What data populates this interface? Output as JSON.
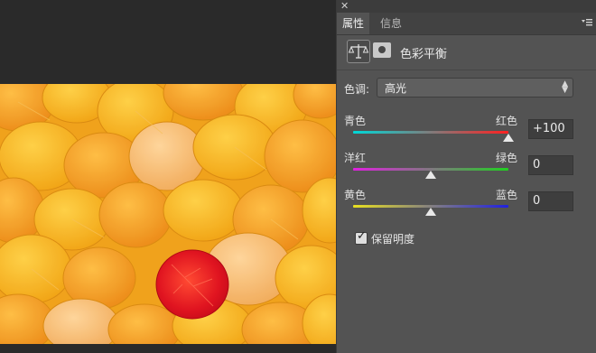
{
  "panel": {
    "tabs": [
      {
        "label": "属性"
      },
      {
        "label": "信息"
      }
    ],
    "title": "色彩平衡",
    "tone": {
      "label": "色调:",
      "value": "高光"
    },
    "sliders": [
      {
        "left_label": "青色",
        "right_label": "红色",
        "value": "+100",
        "position": 100
      },
      {
        "left_label": "洋红",
        "right_label": "绿色",
        "value": "0",
        "position": 0
      },
      {
        "left_label": "黄色",
        "right_label": "蓝色",
        "value": "0",
        "position": 0
      }
    ],
    "preserve_luminosity": {
      "label": "保留明度",
      "checked": true
    }
  },
  "icons": {
    "close": "close-icon",
    "panel_menu": "panel-menu-icon",
    "adjustment": "balance-scale-icon",
    "mask": "layer-mask-icon",
    "select_arrows": "select-arrows-icon",
    "check": "checkmark-icon"
  },
  "colors": {
    "panel_bg": "#535353",
    "workspace_bg": "#2a2a2a",
    "thumb": "#e8e8e8"
  }
}
